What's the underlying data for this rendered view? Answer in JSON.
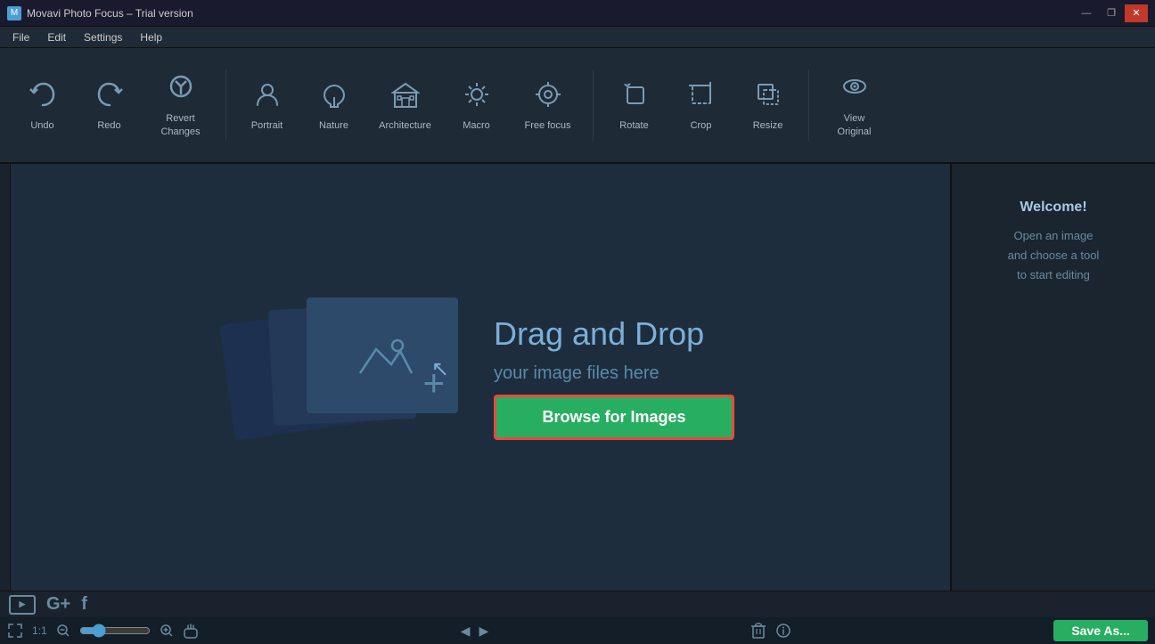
{
  "titleBar": {
    "title": "Movavi Photo Focus – Trial version",
    "controls": {
      "minimize": "—",
      "maximize": "❐",
      "close": "✕"
    }
  },
  "menuBar": {
    "items": [
      "File",
      "Edit",
      "Settings",
      "Help"
    ]
  },
  "toolbar": {
    "buttons": [
      {
        "id": "undo",
        "label": "Undo",
        "icon": "↩"
      },
      {
        "id": "redo",
        "label": "Redo",
        "icon": "↪"
      },
      {
        "id": "revert",
        "label": "Revert\nChanges",
        "icon": "⟳"
      },
      {
        "id": "portrait",
        "label": "Portrait",
        "icon": "👤"
      },
      {
        "id": "nature",
        "label": "Nature",
        "icon": "🌿"
      },
      {
        "id": "architecture",
        "label": "Architecture",
        "icon": "🏛"
      },
      {
        "id": "macro",
        "label": "Macro",
        "icon": "🌸"
      },
      {
        "id": "free-focus",
        "label": "Free focus",
        "icon": "◎"
      },
      {
        "id": "rotate",
        "label": "Rotate",
        "icon": "🔄"
      },
      {
        "id": "crop",
        "label": "Crop",
        "icon": "⬜"
      },
      {
        "id": "resize",
        "label": "Resize",
        "icon": "⤡"
      },
      {
        "id": "view-original",
        "label": "View\nOriginal",
        "icon": "👁"
      }
    ]
  },
  "canvas": {
    "dragDropTitle": "Drag and Drop",
    "dragDropSubtitle": "your image files here",
    "browseButton": "Browse for Images"
  },
  "rightPanel": {
    "welcomeTitle": "Welcome!",
    "welcomeText": "Open an image\nand choose a tool\nto start editing"
  },
  "bottomBar": {
    "socialIcons": [
      "YT",
      "G+",
      "f"
    ]
  },
  "statusBar": {
    "fitToWindow": "⤢",
    "zoomRatio": "1:1",
    "zoomOut": "–",
    "zoomIn": "+",
    "hand": "✋",
    "prevArrow": "◀",
    "nextArrow": "▶",
    "delete": "🗑",
    "info": "ℹ",
    "saveAs": "Save As..."
  }
}
